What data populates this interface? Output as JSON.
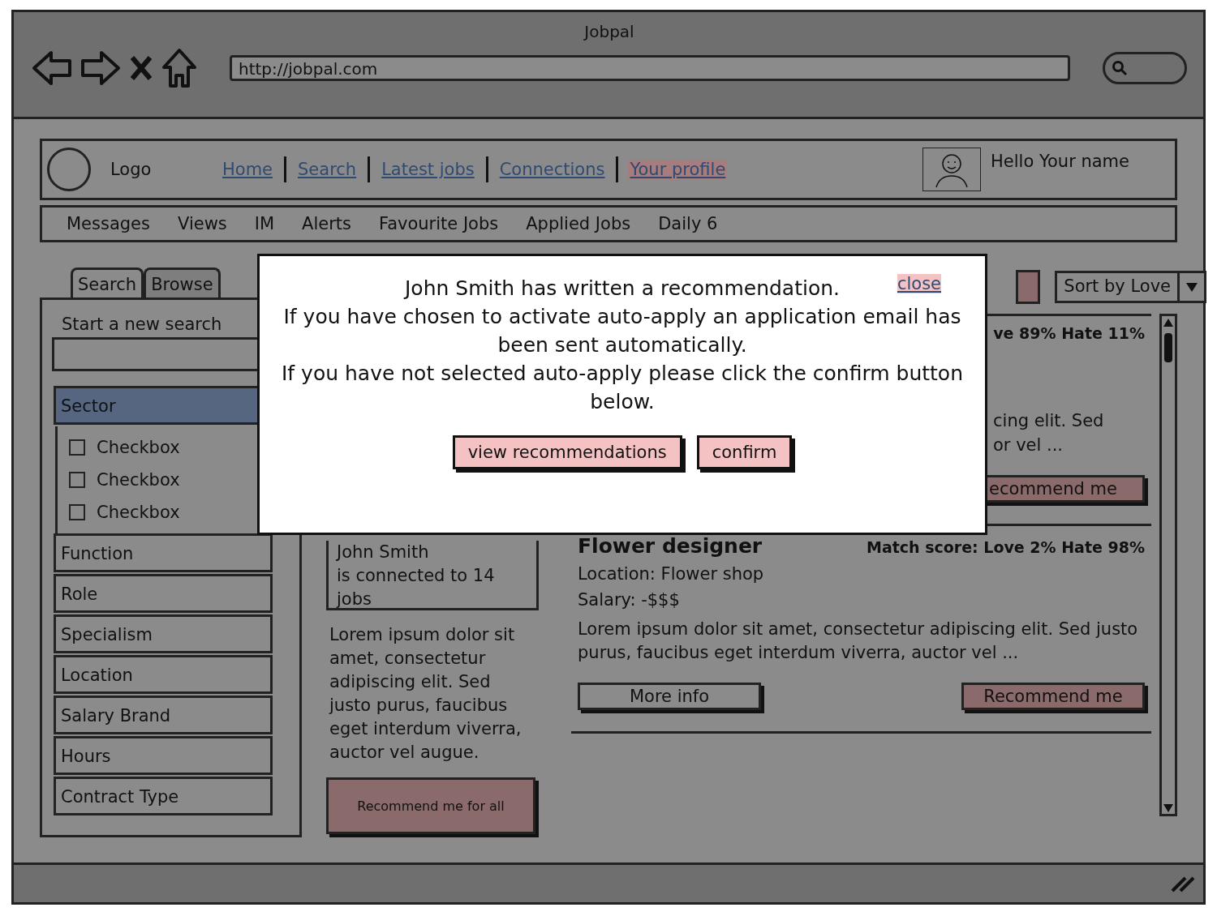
{
  "browser": {
    "title": "Jobpal",
    "url": "http://jobpal.com"
  },
  "header": {
    "logo": "Logo",
    "nav": [
      {
        "label": "Home",
        "selected": false
      },
      {
        "label": "Search",
        "selected": false
      },
      {
        "label": "Latest jobs",
        "selected": false
      },
      {
        "label": "Connections",
        "selected": false
      },
      {
        "label": "Your profile",
        "selected": true
      }
    ],
    "greeting": "Hello Your name"
  },
  "menu": [
    "Messages",
    "Views",
    "IM",
    "Alerts",
    "Favourite Jobs",
    "Applied Jobs",
    "Daily 6"
  ],
  "sidebar": {
    "tabs": [
      {
        "label": "Search",
        "selected": true
      },
      {
        "label": "Browse",
        "selected": false
      }
    ],
    "search_label": "Start a new search",
    "filters": [
      {
        "label": "Sector",
        "expanded": true,
        "options": [
          {
            "label": "Checkbox",
            "checked": false
          },
          {
            "label": "Checkbox",
            "checked": false
          },
          {
            "label": "Checkbox",
            "checked": false
          }
        ]
      },
      {
        "label": "Function",
        "expanded": false
      },
      {
        "label": "Role",
        "expanded": false
      },
      {
        "label": "Specialism",
        "expanded": false
      },
      {
        "label": "Location",
        "expanded": false
      },
      {
        "label": "Salary Brand",
        "expanded": false
      },
      {
        "label": "Hours",
        "expanded": false
      },
      {
        "label": "Contract Type",
        "expanded": false
      }
    ]
  },
  "connection": {
    "name": "John Smith",
    "text": "is connected to 14 jobs"
  },
  "middle": {
    "text": "Lorem ipsum dolor sit amet, consectetur adipiscing elit. Sed justo purus, faucibus eget interdum viverra, auctor vel augue.",
    "button": "Recommend me for all"
  },
  "sort": {
    "value": "Sort by Love"
  },
  "jobs": [
    {
      "kind": "covered",
      "score": "ve 89%  Hate 11%",
      "lines": [
        "cing elit. Sed",
        "or vel ..."
      ],
      "recommend": "ecommend me"
    },
    {
      "kind": "full",
      "title": "Flower designer",
      "score": "Match score:  Love 2%  Hate 98%",
      "location": "Location: Flower shop",
      "salary": "Salary: -$$$",
      "description": "Lorem ipsum dolor sit amet, consectetur adipiscing elit. Sed justo purus, faucibus eget interdum viverra, auctor vel ...",
      "more": "More info",
      "recommend": "Recommend me"
    }
  ],
  "modal": {
    "close": "close",
    "lines": [
      "John Smith has written a recommendation.",
      "If you have chosen to activate auto-apply an application email has been sent automatically.",
      "If you have not selected auto-apply please click the confirm button below."
    ],
    "buttons": [
      "view recommendations",
      "confirm"
    ]
  }
}
